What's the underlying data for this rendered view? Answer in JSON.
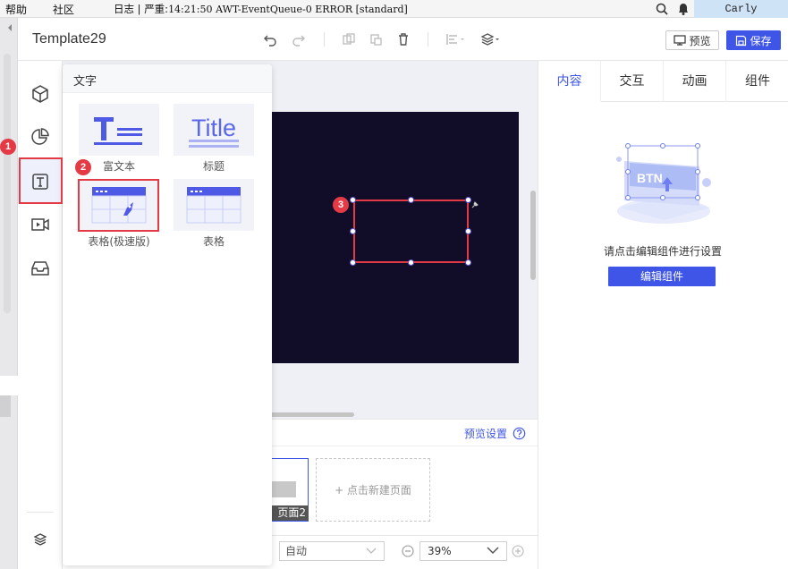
{
  "menubar": {
    "help": "帮助",
    "community": "社区",
    "log_label": "日志",
    "log_sep": "|",
    "log_level": "严重:",
    "log_time": "14:21:50",
    "log_text": "AWT-EventQueue-0 ERROR [standard]",
    "user": "Carly"
  },
  "header": {
    "title": "Template29",
    "preview_label": "预览",
    "save_label": "保存"
  },
  "popover": {
    "title": "文字",
    "items": [
      {
        "label": "富文本",
        "icon": "rich-text-icon"
      },
      {
        "label": "标题",
        "icon": "title-icon",
        "thumb_text": "Title"
      },
      {
        "label": "表格(极速版)",
        "icon": "fast-table-icon"
      },
      {
        "label": "表格",
        "icon": "table-icon"
      }
    ]
  },
  "pages": {
    "preview_settings": "预览设置",
    "page_label": "页面2",
    "new_page": "+ 点击新建页面"
  },
  "bottom": {
    "auto_label": "自动",
    "zoom": "39%"
  },
  "right_panel": {
    "tabs": [
      "内容",
      "交互",
      "动画",
      "组件"
    ],
    "active_tab": "内容",
    "illustration_text": "BTN",
    "hint": "请点击编辑组件进行设置",
    "edit_button": "编辑组件"
  },
  "annotations": [
    "1",
    "2",
    "3"
  ],
  "colors": {
    "accent": "#3e55e8",
    "annotation_red": "#e43a45",
    "artboard": "#110d29"
  }
}
